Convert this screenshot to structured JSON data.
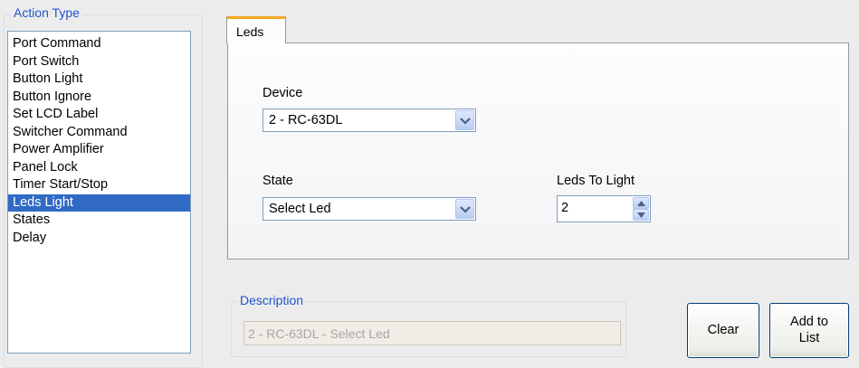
{
  "action_type": {
    "title": "Action Type",
    "items": [
      {
        "label": "Port Command"
      },
      {
        "label": "Port Switch"
      },
      {
        "label": "Button Light"
      },
      {
        "label": "Button Ignore"
      },
      {
        "label": "Set LCD Label"
      },
      {
        "label": "Switcher Command"
      },
      {
        "label": "Power Amplifier"
      },
      {
        "label": "Panel Lock"
      },
      {
        "label": "Timer Start/Stop"
      },
      {
        "label": "Leds Light",
        "selected": true
      },
      {
        "label": "States"
      },
      {
        "label": "Delay"
      }
    ]
  },
  "tab": {
    "label": "Leds",
    "accent": "#f5a623"
  },
  "device": {
    "label": "Device",
    "value": "2 - RC-63DL"
  },
  "state": {
    "label": "State",
    "value": "Select Led"
  },
  "leds_to_light": {
    "label": "Leds To Light",
    "value": "2"
  },
  "description": {
    "title": "Description",
    "value": "2 - RC-63DL - Select Led"
  },
  "buttons": {
    "clear": "Clear",
    "add_to_list": "Add to\nList"
  },
  "colors": {
    "selection": "#316ac5",
    "group_title": "#2255cc"
  },
  "icons": {
    "dropdown": "chevron-down-icon",
    "spin_up": "arrow-up-icon",
    "spin_down": "arrow-down-icon"
  }
}
